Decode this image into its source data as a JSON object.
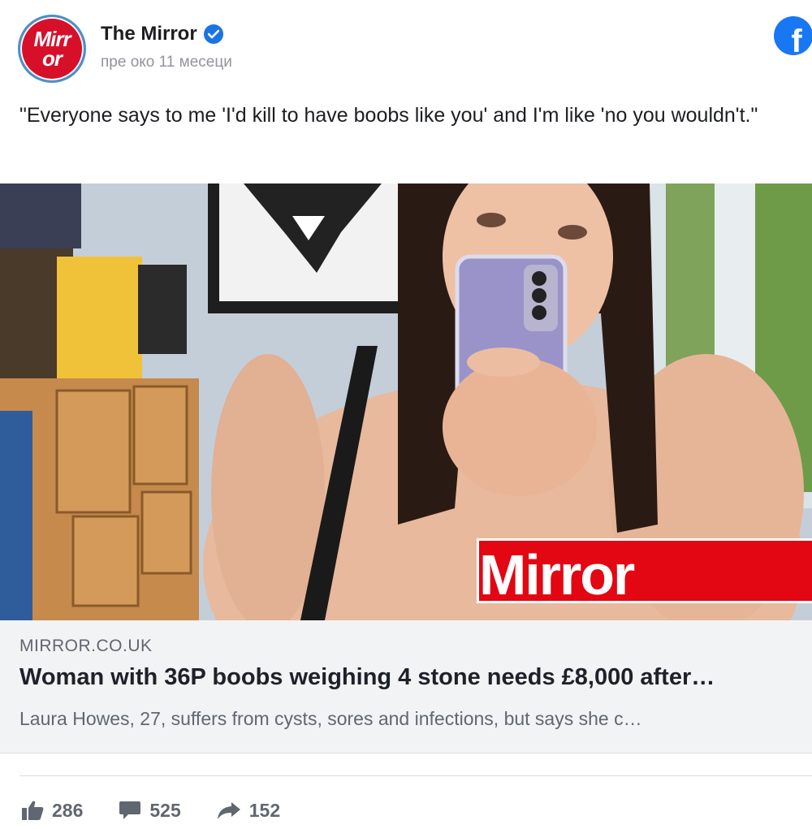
{
  "post": {
    "page_name": "The Mirror",
    "time": "пре око 11 месеци",
    "text": "\"Everyone says to me 'I'd kill to have boobs like you' and I'm like 'no you wouldn't.\"",
    "avatar_logo": "Mirror",
    "social_icon": "facebook-icon"
  },
  "photo": {
    "watermark": "Mirror"
  },
  "link": {
    "domain": "MIRROR.CO.UK",
    "headline": "Woman with 36P boobs weighing 4 stone needs £8,000 after…",
    "description": "Laura Howes, 27, suffers from cysts, sores and infections, but says she c…"
  },
  "stats": {
    "likes": "286",
    "comments": "525",
    "shares": "152"
  },
  "colors": {
    "brand_red": "#e30613",
    "facebook_blue": "#1877f2",
    "verified_blue": "#1b74e4"
  }
}
